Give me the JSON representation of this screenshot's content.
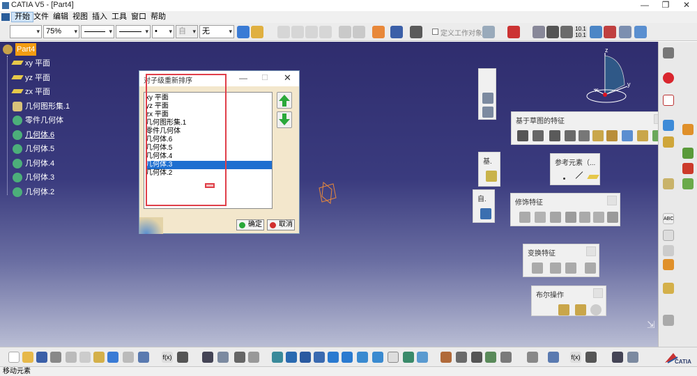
{
  "window": {
    "title": "CATIA V5 - [Part4]",
    "minimize": "—",
    "restore": "❐",
    "close": "✕"
  },
  "menu": [
    "开始",
    "文件",
    "编辑",
    "视图",
    "插入",
    "工具",
    "窗口",
    "帮助"
  ],
  "toolbar": {
    "zoom_value": "75%",
    "combo_auto": "自",
    "combo_none": "无",
    "work_object_label": "定义工作对象",
    "dot_value": "•"
  },
  "tree": {
    "root": "Part4",
    "items": [
      {
        "label": "xy 平面",
        "icon": "plane-icon"
      },
      {
        "label": "yz 平面",
        "icon": "plane-icon"
      },
      {
        "label": "zx 平面",
        "icon": "plane-icon"
      },
      {
        "label": "几何图形集.1",
        "icon": "geometrical-set-icon"
      },
      {
        "label": "零件几何体",
        "icon": "part-body-icon"
      },
      {
        "label": "几何体.6",
        "icon": "body-icon"
      },
      {
        "label": "几何体.5",
        "icon": "body-icon"
      },
      {
        "label": "几何体.4",
        "icon": "body-icon"
      },
      {
        "label": "几何体.3",
        "icon": "body-icon"
      },
      {
        "label": "几何体.2",
        "icon": "body-icon"
      }
    ]
  },
  "dialog": {
    "title": "对子级重新排序",
    "items": [
      "xy 平面",
      "yz 平面",
      "zx 平面",
      "几何图形集.1",
      "零件几何体",
      "几何体.6",
      "几何体.5",
      "几何体.4",
      "几何体.3",
      "几何体.2"
    ],
    "selected_index": 8,
    "ok_label": "确定",
    "cancel_label": "取消"
  },
  "panels": {
    "sketch_features": "基于草图的特征",
    "reference_elements": "参考元素（...",
    "dress_up": "修饰特征",
    "transform": "变换特征",
    "boolean": "布尔操作",
    "sketch_short": "基.",
    "auto_short": "自."
  },
  "compass": {
    "x": "x",
    "y": "y",
    "z": "z"
  },
  "status": {
    "message": "移动元素"
  },
  "brand": {
    "name": "CATIA"
  },
  "colors": {
    "accent_orange": "#f39c12",
    "selection_blue": "#1e6fd0",
    "viewport_top": "#2f2d6e",
    "viewport_bottom": "#b9bdd4",
    "annotation_red": "#e0404a"
  }
}
